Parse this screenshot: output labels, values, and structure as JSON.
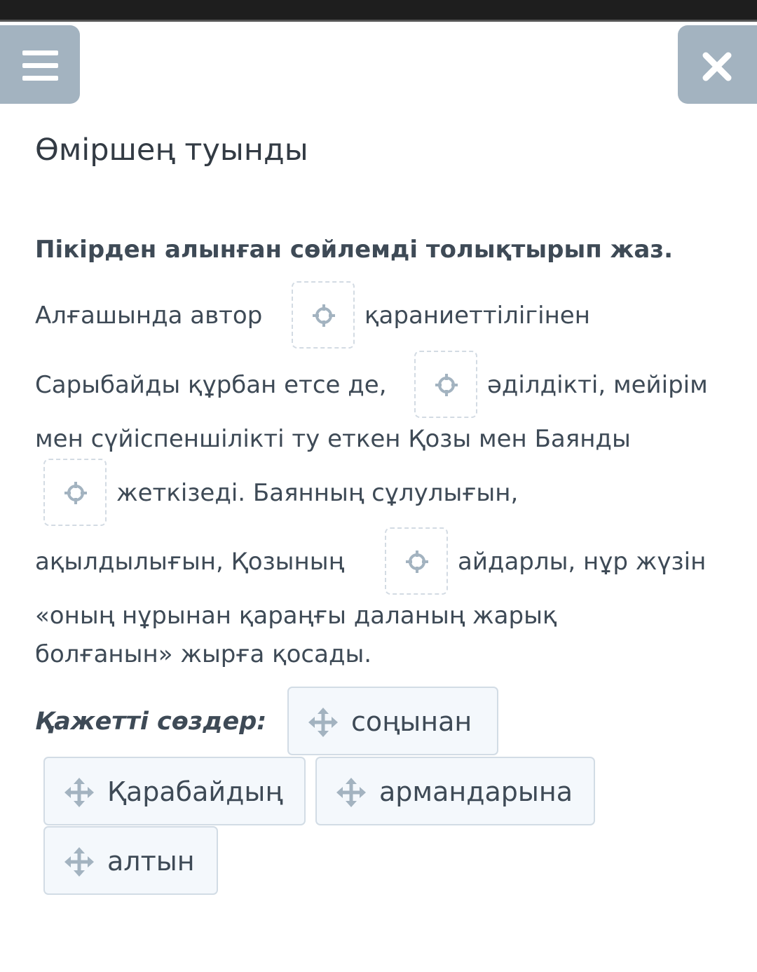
{
  "header": {
    "menu_icon": "hamburger-menu-icon",
    "close_icon": "close-x-icon"
  },
  "title": "Өміршең туынды",
  "instruction": "Пікірден алынған сөйлемді толықтырып жаз.",
  "text_lines": [
    "Алғашында автор",
    "қарaниеттілігінен",
    "Сарыбайды құрбан етсе де,",
    "әділдікті, мейірім",
    "мен сүйіспеншілікті ту еткен Қозы мен Баянды",
    "жеткізеді. Баянның сұлулығын,",
    "ақылдылығын, Қозының",
    "айдарлы, нұр жүзін",
    "«оның нұрынан қараңғы даланың жарық",
    "болғанын» жырға қосады."
  ],
  "drop_zone_icon": "target-crosshair-icon",
  "words_label": "Қажетті сөздер:",
  "chip_icon": "move-arrows-icon",
  "words": [
    "соңынан",
    "Қарабайдың",
    "армандарына",
    "алтын"
  ],
  "colors": {
    "button_bg": "#a3b3c0",
    "text": "#3e4a56",
    "chip_bg": "#f4f8fc",
    "chip_border": "#d2dce5",
    "gap_border": "#d3dbe3",
    "icon": "#a3b3c0"
  }
}
